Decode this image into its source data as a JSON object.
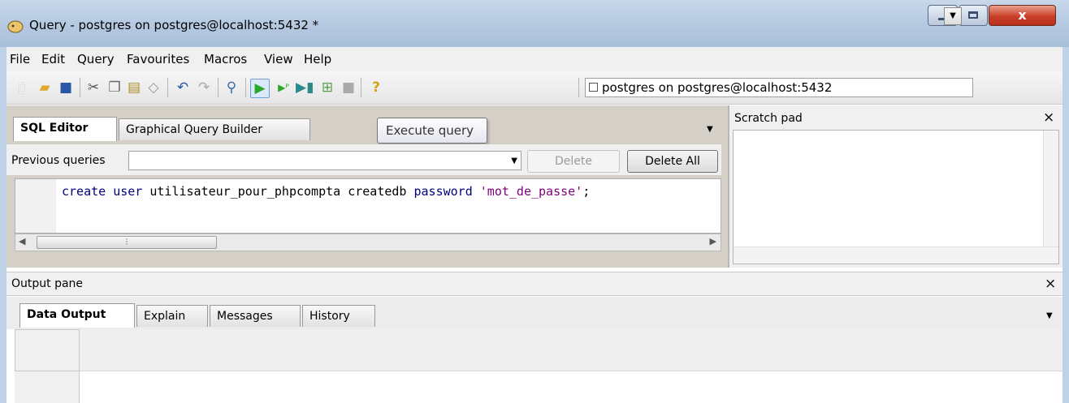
{
  "window": {
    "title": "Query - postgres on postgres@localhost:5432 *",
    "close_glyph": "x"
  },
  "menu": [
    "File",
    "Edit",
    "Query",
    "Favourites",
    "Macros",
    "View",
    "Help"
  ],
  "toolbar": {
    "icons": [
      "new-icon",
      "open-icon",
      "save-icon",
      "cut-icon",
      "copy-icon",
      "paste-icon",
      "clear-icon",
      "undo-icon",
      "redo-icon",
      "find-icon",
      "execute-icon",
      "execute-pgscript-icon",
      "execute-to-file-icon",
      "explain-icon",
      "cancel-icon",
      "help-icon"
    ],
    "connection": "postgres on postgres@localhost:5432"
  },
  "editor": {
    "tabs": [
      "SQL Editor",
      "Graphical Query Builder"
    ],
    "tooltip": "Execute query",
    "previous_queries_label": "Previous queries",
    "delete_label": "Delete",
    "delete_all_label": "Delete All",
    "code": {
      "kw_create": "create",
      "kw_user": "user",
      "ident_user": "utilisateur_pour_phpcompta",
      "ident_createdb": "createdb",
      "kw_password": "password",
      "str_password": "'mot_de_passe'",
      "end": ";"
    }
  },
  "scratch": {
    "title": "Scratch pad",
    "close_glyph": "×"
  },
  "output": {
    "title": "Output pane",
    "close_glyph": "×",
    "tabs": [
      "Data Output",
      "Explain",
      "Messages",
      "History"
    ]
  }
}
